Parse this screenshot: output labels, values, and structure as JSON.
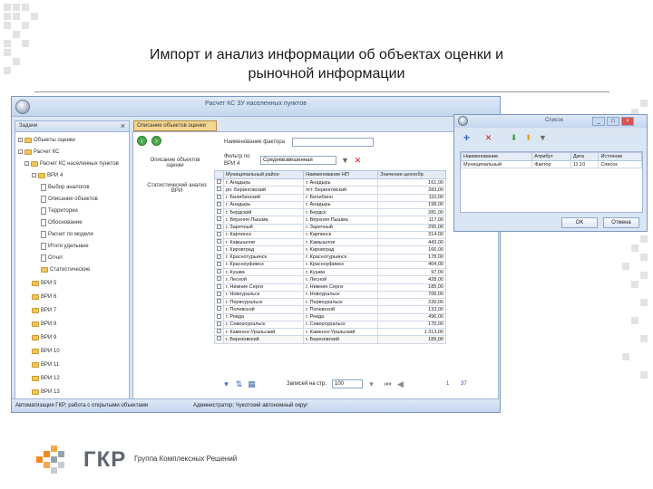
{
  "slide": {
    "title_line1": "Импорт и анализ информации об объектах оценки и",
    "title_line2": "рыночной информации"
  },
  "window": {
    "title": "Расчет КС ЗУ населенных пунктов"
  },
  "tree": {
    "header": "Задачи",
    "close": "×",
    "items": [
      {
        "label": "Объекты оценки"
      },
      {
        "label": "Расчет КС"
      },
      {
        "label": "Расчет КС населенных пунктов"
      },
      {
        "label": "ВРИ 4"
      },
      {
        "label": "Выбор аналогов"
      },
      {
        "label": "Описание объектов"
      },
      {
        "label": "Территории"
      },
      {
        "label": "Обоснование"
      },
      {
        "label": "Расчет по модели"
      },
      {
        "label": "Итоги удельные"
      },
      {
        "label": "Отчет"
      },
      {
        "label": "Статистические"
      },
      {
        "label": "ВРИ 5"
      },
      {
        "label": "ВРИ 6"
      },
      {
        "label": "ВРИ 7"
      },
      {
        "label": "ВРИ 8"
      },
      {
        "label": "ВРИ 9"
      },
      {
        "label": "ВРИ 10"
      },
      {
        "label": "ВРИ 11"
      },
      {
        "label": "ВРИ 12"
      },
      {
        "label": "ВРИ 13"
      },
      {
        "label": "ВРИ 14"
      }
    ]
  },
  "tab": {
    "label": "Описание объектов оценки"
  },
  "content": {
    "left_label1": "Описание объектов",
    "left_label1b": "оценки",
    "left_label2": "Статистический анализ",
    "left_value2": "ВРИ",
    "factor_label": "Наименование фактора",
    "filter_label": "Фильтр по",
    "filter_field": "Средневзвешенная",
    "filter_sub": "ВРИ 4"
  },
  "grid": {
    "columns": [
      "Муниципальный район",
      "Наименование НП",
      "Значение ценообр."
    ],
    "rows": [
      {
        "district": "г. Анадырь",
        "np": "г. Анадырь",
        "value": "161,00"
      },
      {
        "district": "рп. Беринговский",
        "np": "пгт. Беринговский",
        "value": "283,00"
      },
      {
        "district": "г. Билибинский",
        "np": "г. Билибино",
        "value": "110,00"
      },
      {
        "district": "г. Анадырь",
        "np": "г. Анадырь",
        "value": "198,00"
      },
      {
        "district": "г. Бердский",
        "np": "г. Бердск",
        "value": "281,00"
      },
      {
        "district": "г. Верхняя Пышма",
        "np": "г. Верхняя Пышма",
        "value": "117,00"
      },
      {
        "district": "г. Заречный",
        "np": "г. Заречный",
        "value": "295,00"
      },
      {
        "district": "г. Карпинск",
        "np": "г. Карпинск",
        "value": "314,00"
      },
      {
        "district": "г. Камышлов",
        "np": "г. Камышлов",
        "value": "443,00"
      },
      {
        "district": "г. Кировград",
        "np": "г. Кировград",
        "value": "166,00"
      },
      {
        "district": "г. Краснотурьинск",
        "np": "г. Краснотурьинск",
        "value": "178,00"
      },
      {
        "district": "г. Красноуфимск",
        "np": "г. Красноуфимск",
        "value": "404,00"
      },
      {
        "district": "г. Кушва",
        "np": "г. Кушва",
        "value": "97,00"
      },
      {
        "district": "г. Лесной",
        "np": "г. Лесной",
        "value": "428,00"
      },
      {
        "district": "г. Нижние Серги",
        "np": "г. Нижние Серги",
        "value": "185,00"
      },
      {
        "district": "г. Новоуральск",
        "np": "г. Новоуральск",
        "value": "706,00"
      },
      {
        "district": "г. Первоуральск",
        "np": "г. Первоуральск",
        "value": "226,00"
      },
      {
        "district": "г. Полевской",
        "np": "г. Полевской",
        "value": "133,00"
      },
      {
        "district": "г. Ревда",
        "np": "г. Ревда",
        "value": "496,00"
      },
      {
        "district": "г. Североуральск",
        "np": "г. Североуральск",
        "value": "170,00"
      },
      {
        "district": "г. Каменск-Уральский",
        "np": "г. Каменск-Уральский",
        "value": "1 313,00"
      },
      {
        "district": "г. Березовский",
        "np": "г. Березовский",
        "value": "189,00"
      }
    ]
  },
  "pager": {
    "label": "Записей на стр.",
    "per_page": "100",
    "page": "1",
    "total": "37"
  },
  "statusbar": {
    "left": "Автоматизация ГКР; работа с открытыми объектами",
    "right": "Администратор; Чукотский автономный округ"
  },
  "dialog": {
    "title": "Список",
    "min": "_",
    "max": "□",
    "close": "×",
    "columns": [
      "Наименование",
      "Атрибут",
      "Дата",
      "Источник"
    ],
    "rows": [
      {
        "name": "Муниципальный",
        "attr": "Фактор",
        "date": "11.10",
        "src": "Список"
      }
    ],
    "ok": "OK",
    "cancel": "Отмена"
  },
  "footer": {
    "logo": "ГКР",
    "caption": "Группа Комплексных Решений"
  },
  "colors": {
    "window_bg": "#dbe6f4",
    "accent_orange": "#f28a1e",
    "tab_active": "#f4d591"
  }
}
